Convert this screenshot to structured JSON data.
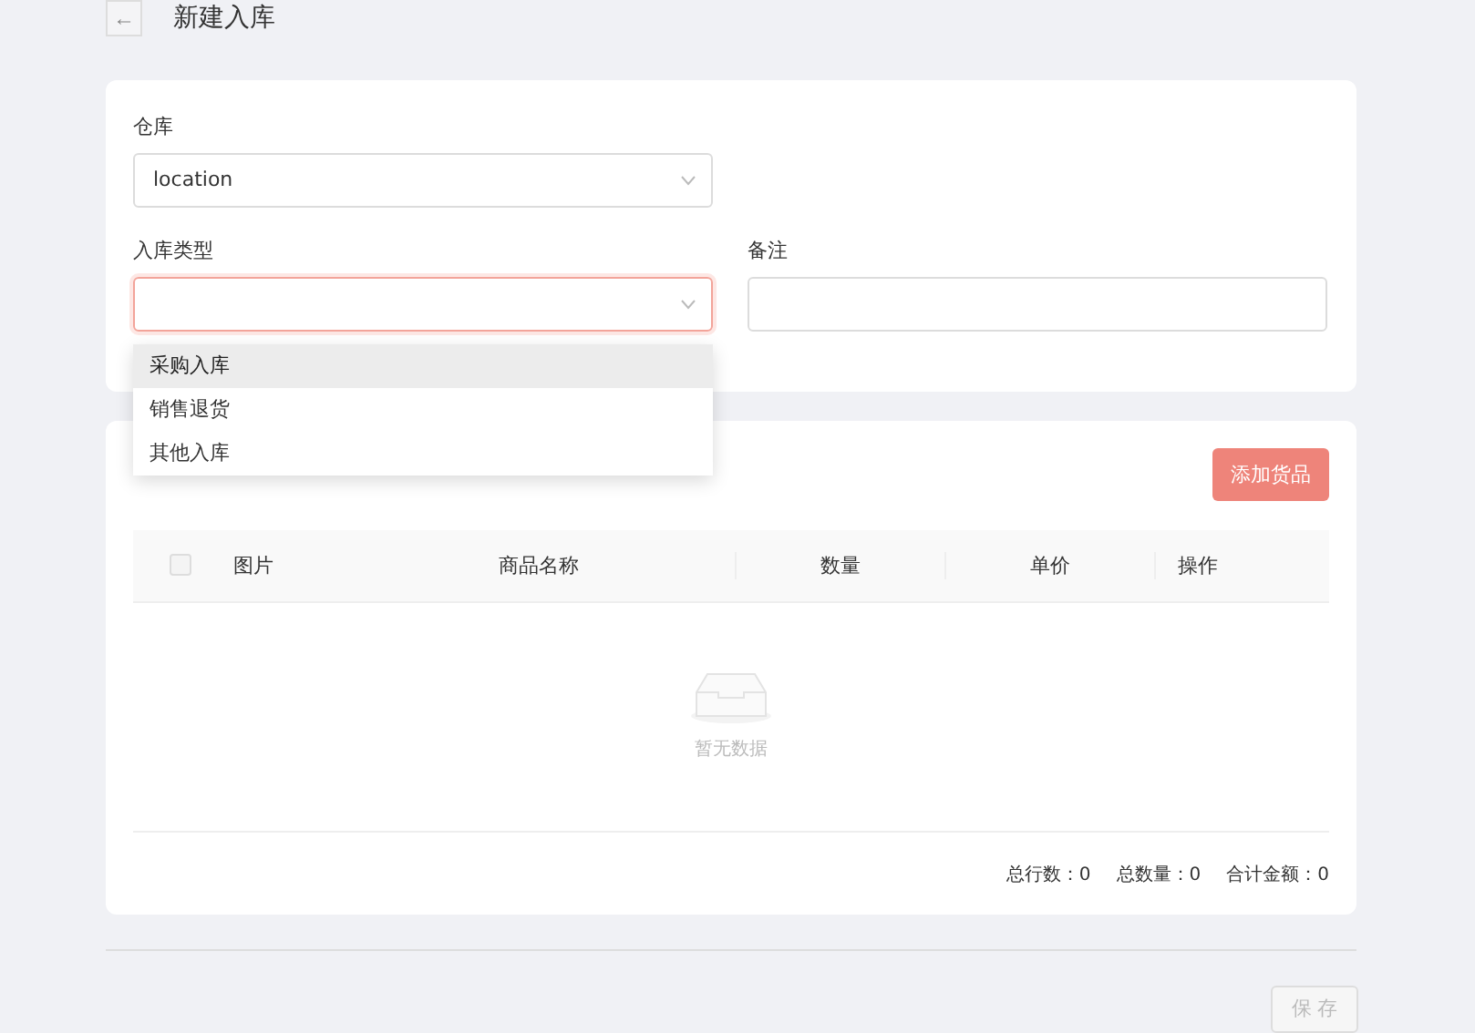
{
  "header": {
    "back_icon": "←",
    "title": "新建入库"
  },
  "form": {
    "warehouse": {
      "label": "仓库",
      "value": "location"
    },
    "type": {
      "label": "入库类型",
      "focused": true,
      "open": true,
      "options": [
        {
          "label": "采购入库",
          "selected": true
        },
        {
          "label": "销售退货",
          "selected": false
        },
        {
          "label": "其他入库",
          "selected": false
        }
      ]
    },
    "remark": {
      "label": "备注"
    }
  },
  "goods": {
    "add_button": "添加货品",
    "columns": [
      "图片",
      "商品名称",
      "数量",
      "单价",
      "操作"
    ],
    "select_all_checked": false,
    "empty_text": "暂无数据",
    "summary": [
      {
        "label": "总行数：",
        "value": "0"
      },
      {
        "label": "总数量：",
        "value": "0"
      },
      {
        "label": "合计金额：",
        "value": "0"
      }
    ]
  },
  "save_button": {
    "label": "保 存",
    "disabled": true
  }
}
